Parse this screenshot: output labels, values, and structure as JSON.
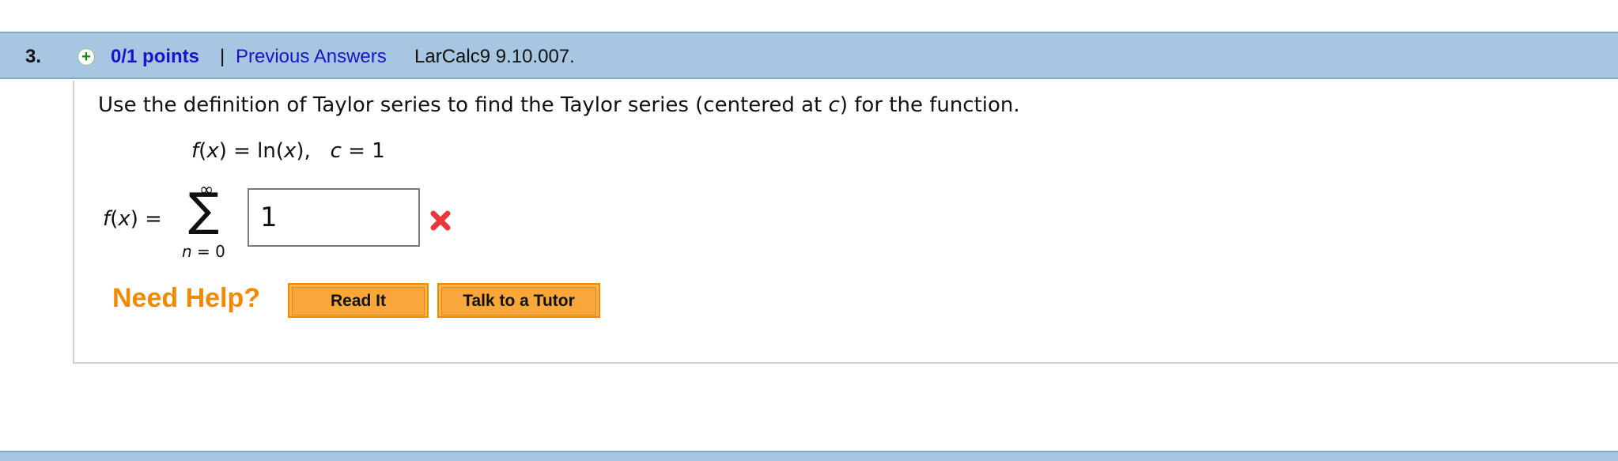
{
  "header": {
    "question_number": "3.",
    "points": "0/1 points",
    "separator": "|",
    "previous_answers": "Previous Answers",
    "source": "LarCalc9 9.10.007."
  },
  "question": {
    "prompt_before": "Use the definition of Taylor series to find the Taylor series (centered at ",
    "prompt_var": "c",
    "prompt_after": ") for the function.",
    "given": {
      "f": "f",
      "open": "(",
      "x": "x",
      "rest": ") = ln(",
      "x2": "x",
      "close": "),",
      "c_var": "c",
      "c_value": " = 1"
    },
    "series_label": {
      "f": "f",
      "open": "(",
      "x": "x",
      "close": ") ="
    },
    "sum_upper": "∞",
    "sum_symbol": "∑",
    "sum_lower_var": "n",
    "sum_lower_rest": " = 0",
    "answer_value": "1",
    "answer_status": "incorrect"
  },
  "help": {
    "label": "Need Help?",
    "read_it": "Read It",
    "talk_to_tutor": "Talk to a Tutor"
  },
  "colors": {
    "header_bg": "#a6c6e1",
    "link": "#1a14c9",
    "help_orange": "#f08a00",
    "button_fill": "#f9a73a",
    "incorrect_red": "#e8383a"
  }
}
